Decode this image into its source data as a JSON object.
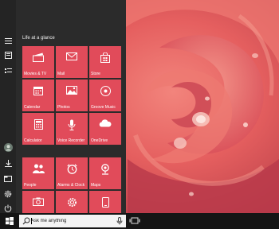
{
  "start_menu": {
    "group_title": "Life at a glance",
    "rail_icons": [
      "hamburger-icon",
      "all-apps-icon",
      "list-icon",
      "user-avatar-icon",
      "downloads-icon",
      "file-explorer-icon",
      "settings-icon",
      "power-icon"
    ],
    "tiles": [
      {
        "label": "Movies & TV",
        "icon": "clapperboard-icon"
      },
      {
        "label": "Mail",
        "icon": "envelope-icon"
      },
      {
        "label": "Store",
        "icon": "shopping-bag-icon"
      },
      {
        "label": "Calendar",
        "icon": "calendar-icon"
      },
      {
        "label": "Photos",
        "icon": "image-icon"
      },
      {
        "label": "Groove Music",
        "icon": "disc-icon"
      },
      {
        "label": "Calculator",
        "icon": "calculator-icon"
      },
      {
        "label": "Voice Recorder",
        "icon": "microphone-icon"
      },
      {
        "label": "OneDrive",
        "icon": "cloud-icon"
      },
      {
        "label": "People",
        "icon": "people-icon"
      },
      {
        "label": "Alarms & Clock",
        "icon": "alarm-clock-icon"
      },
      {
        "label": "Maps",
        "icon": "map-icon"
      },
      {
        "label": "",
        "icon": "camera-icon"
      },
      {
        "label": "",
        "icon": "gear-icon"
      },
      {
        "label": "",
        "icon": "phone-icon"
      }
    ],
    "tile_color": "#e14b5a",
    "menu_background": "#2b2b2b"
  },
  "taskbar": {
    "search_placeholder": "Ask me anything",
    "start_icon": "windows-logo-icon",
    "search_icon": "search-icon",
    "mic_icon": "microphone-icon",
    "task_view_icon": "task-view-icon"
  }
}
